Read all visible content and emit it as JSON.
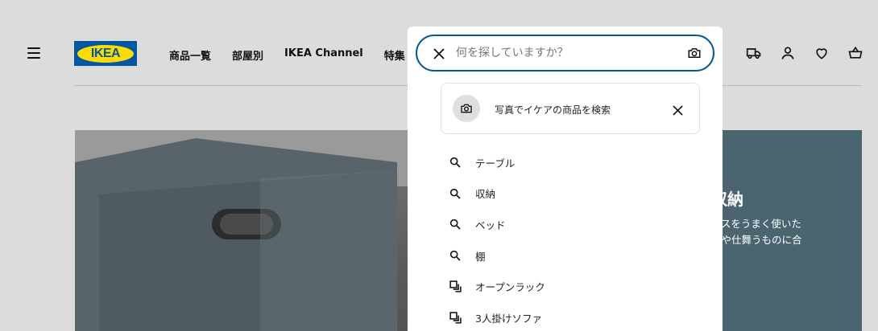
{
  "header": {
    "logo_text": "IKEA",
    "nav": [
      "商品一覧",
      "部屋別",
      "IKEA Channel",
      "特集"
    ]
  },
  "hero": {
    "title": "収納",
    "line1": "ースをうまく使いた",
    "line2": "入や仕舞うものに合"
  },
  "search": {
    "placeholder": "何を探していますか？",
    "value": "",
    "visual_search_label": "写真でイケアの商品を検索",
    "suggestions": [
      {
        "type": "search-icon",
        "label": "テーブル"
      },
      {
        "type": "search-icon",
        "label": "収納"
      },
      {
        "type": "search-icon",
        "label": "ベッド"
      },
      {
        "type": "search-icon",
        "label": "棚"
      },
      {
        "type": "category-icon",
        "label": "オープンラック"
      },
      {
        "type": "category-icon",
        "label": "3人掛けソファ"
      }
    ]
  },
  "colors": {
    "accent": "#0058a3",
    "logo_yellow": "#ffdb00",
    "hero_panel": "#4b6570"
  }
}
